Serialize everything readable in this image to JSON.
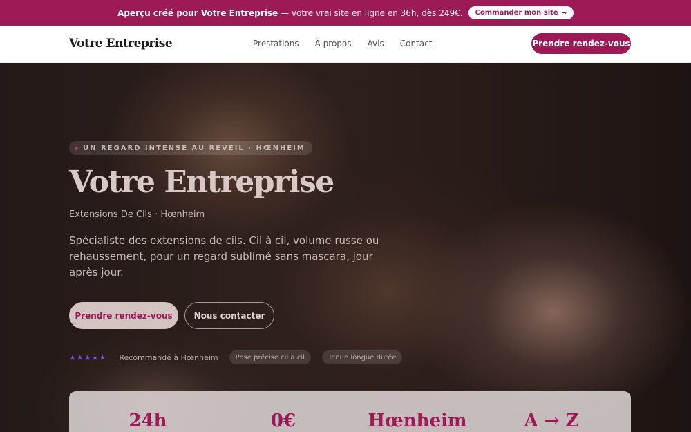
{
  "announcement": {
    "strong": "Aperçu créé pour Votre Entreprise",
    "rest": "— votre vrai site en ligne en 36h, dès 249€.",
    "cta": "Commander mon site",
    "cta_arrow": "→"
  },
  "nav": {
    "brand": "Votre Entreprise",
    "links": [
      "Prestations",
      "À propos",
      "Avis",
      "Contact"
    ],
    "cta": "Prendre rendez-vous"
  },
  "hero": {
    "eyebrow": "UN REGARD INTENSE AU RÉVEIL · HŒNHEIM",
    "title": "Votre Entreprise",
    "subtitle": "Extensions De Cils · Hœnheim",
    "description": "Spécialiste des extensions de cils. Cil à cil, volume russe ou rehaussement, pour un regard sublimé sans mascara, jour après jour.",
    "primary_cta": "Prendre rendez-vous",
    "secondary_cta": "Nous contacter",
    "stars": "★★★★★",
    "trust_text": "Recommandé à Hœnheim",
    "chips": [
      "Pose précise cil à cil",
      "Tenue longue durée"
    ]
  },
  "stats": [
    "24h",
    "0€",
    "Hœnheim",
    "A → Z"
  ],
  "colors": {
    "brand": "#9c1a56",
    "star": "#7d4bd0"
  }
}
